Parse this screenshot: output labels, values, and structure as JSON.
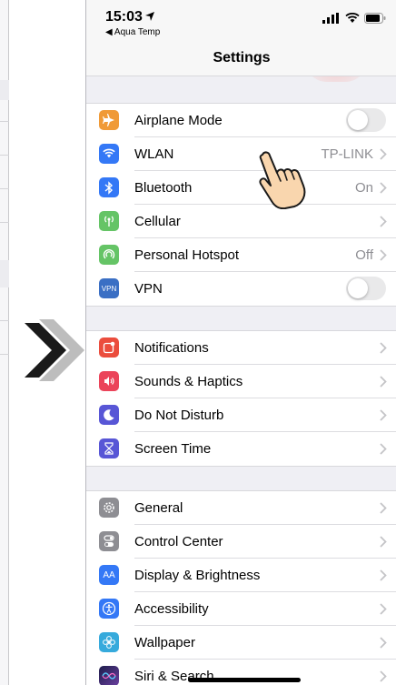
{
  "status_bar": {
    "time": "15:03",
    "back_app": "◀ Aqua Temp"
  },
  "nav": {
    "title": "Settings"
  },
  "groups": [
    {
      "rows": [
        {
          "label": "Airplane Mode",
          "icon": "airplane-icon",
          "color": "#f09a37",
          "control": "toggle",
          "toggle_on": false
        },
        {
          "label": "WLAN",
          "value": "TP-LINK",
          "icon": "wifi-icon",
          "color": "#3478f6",
          "control": "chevron"
        },
        {
          "label": "Bluetooth",
          "value": "On",
          "icon": "bluetooth-icon",
          "color": "#3478f6",
          "control": "chevron"
        },
        {
          "label": "Cellular",
          "icon": "cellular-icon",
          "color": "#65c466",
          "control": "chevron"
        },
        {
          "label": "Personal Hotspot",
          "value": "Off",
          "icon": "hotspot-icon",
          "color": "#65c466",
          "control": "chevron"
        },
        {
          "label": "VPN",
          "icon": "vpn-icon",
          "icon_text": "VPN",
          "color": "#3a6fc4",
          "control": "toggle",
          "toggle_on": false
        }
      ]
    },
    {
      "rows": [
        {
          "label": "Notifications",
          "icon": "notifications-icon",
          "color": "#eb4d3d",
          "control": "chevron"
        },
        {
          "label": "Sounds & Haptics",
          "icon": "speaker-icon",
          "color": "#eb445a",
          "control": "chevron"
        },
        {
          "label": "Do Not Disturb",
          "icon": "moon-icon",
          "color": "#5856d6",
          "control": "chevron"
        },
        {
          "label": "Screen Time",
          "icon": "hourglass-icon",
          "color": "#5856d6",
          "control": "chevron"
        }
      ]
    },
    {
      "rows": [
        {
          "label": "General",
          "icon": "gear-icon",
          "color": "#8e8e93",
          "control": "chevron"
        },
        {
          "label": "Control Center",
          "icon": "toggles-icon",
          "color": "#8e8e93",
          "control": "chevron"
        },
        {
          "label": "Display & Brightness",
          "icon": "text-size-icon",
          "icon_text": "AA",
          "color": "#3478f6",
          "control": "chevron"
        },
        {
          "label": "Accessibility",
          "icon": "accessibility-icon",
          "color": "#3478f6",
          "control": "chevron"
        },
        {
          "label": "Wallpaper",
          "icon": "flower-icon",
          "color": "#36aadc",
          "control": "chevron"
        },
        {
          "label": "Siri & Search",
          "icon": "siri-icon",
          "color": "#2b2b6e",
          "control": "chevron"
        }
      ]
    }
  ]
}
